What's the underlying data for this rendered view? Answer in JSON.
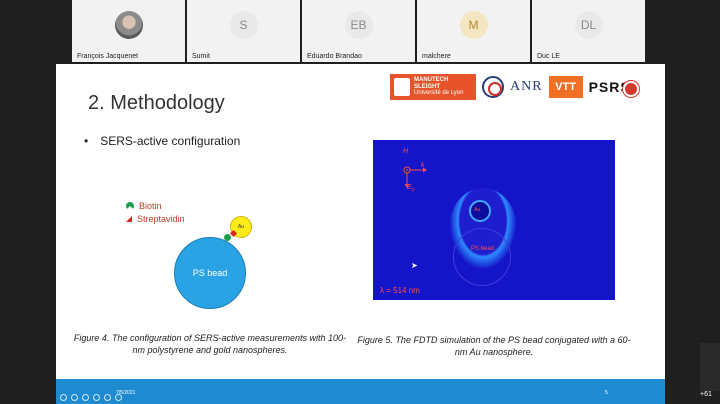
{
  "participants": [
    {
      "initials": "",
      "name": "François Jacquenet",
      "photo": true
    },
    {
      "initials": "S",
      "name": "Sumit"
    },
    {
      "initials": "EB",
      "name": "Eduardo Brandao"
    },
    {
      "initials": "M",
      "name": "malchere"
    },
    {
      "initials": "DL",
      "name": "Duc LE"
    }
  ],
  "slide": {
    "title": "2. Methodology",
    "bullet_mark": "•",
    "bullet": "SERS-active configuration",
    "logos": {
      "manutech_1": "MANUTECH",
      "manutech_2": "SLEIGHT",
      "manutech_3": "Université de Lyon",
      "anr": "ANR",
      "vtt": "VTT",
      "psrs": "PSRS"
    },
    "legend_biotin": "Biotin",
    "legend_strep": "Streptavidin",
    "ps_bead_label": "PS bead",
    "au_label": "Au",
    "caption_left": "Figure 4. The configuration of SERS-active measurements with 100-nm polystyrene and gold nanospheres.",
    "fdtd": {
      "h_label": "H",
      "k_label": "k",
      "e_label": "E",
      "e_sub": "0",
      "au_label": "Au",
      "ps_label": "PS bead",
      "lambda": "λ = 514 nm"
    },
    "caption_right": "Figure 5. The FDTD simulation of the PS bead conjugated with a 60-nm Au nanosphere."
  },
  "footer": {
    "date": "7/5/2021",
    "page": "5",
    "more_participants": "+61"
  }
}
